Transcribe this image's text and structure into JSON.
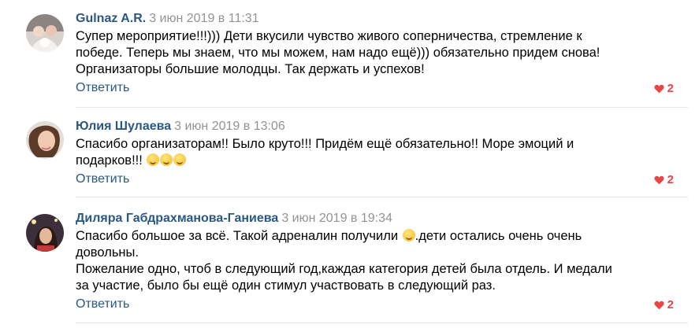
{
  "comments": [
    {
      "author": "Gulnaz A.R.",
      "date": "3 июн 2019 в 11:31",
      "lines": [
        "Супер мероприятие!!!))) Дети вкусили чувство живого соперничества, стремление к",
        "победе. Теперь мы знаем, что мы можем, нам надо ещё))) обязательно придем снова!",
        "Организаторы большие молодцы. Так держать и успехов!"
      ],
      "reply_label": "Ответить",
      "likes": "2"
    },
    {
      "author": "Юлия Шулаева",
      "date": "3 июн 2019 в 13:06",
      "lines": [
        "Спасибо организаторам!! Было круто!!! Придём ещё обязательно!! Море эмоций и",
        "подарков!!!"
      ],
      "reply_label": "Ответить",
      "likes": "2"
    },
    {
      "author": "Диляра Габдрахманова-Ганиева",
      "date": "3 июн 2019 в 19:34",
      "line1_a": "Спасибо большое за всё. Такой адреналин получили",
      "line1_b": ".дети остались очень очень",
      "lines": [
        "довольны.",
        "Пожелание одно, чтоб в следующий год,каждая категория детей была отдель. И медали",
        "за участие, было бы ещё один стимул участвовать в следующий раз."
      ],
      "reply_label": "Ответить",
      "likes": "2"
    }
  ],
  "colors": {
    "link": "#2a5885",
    "meta": "#939393",
    "like": "#e64646",
    "divider": "#e7e8ec"
  }
}
